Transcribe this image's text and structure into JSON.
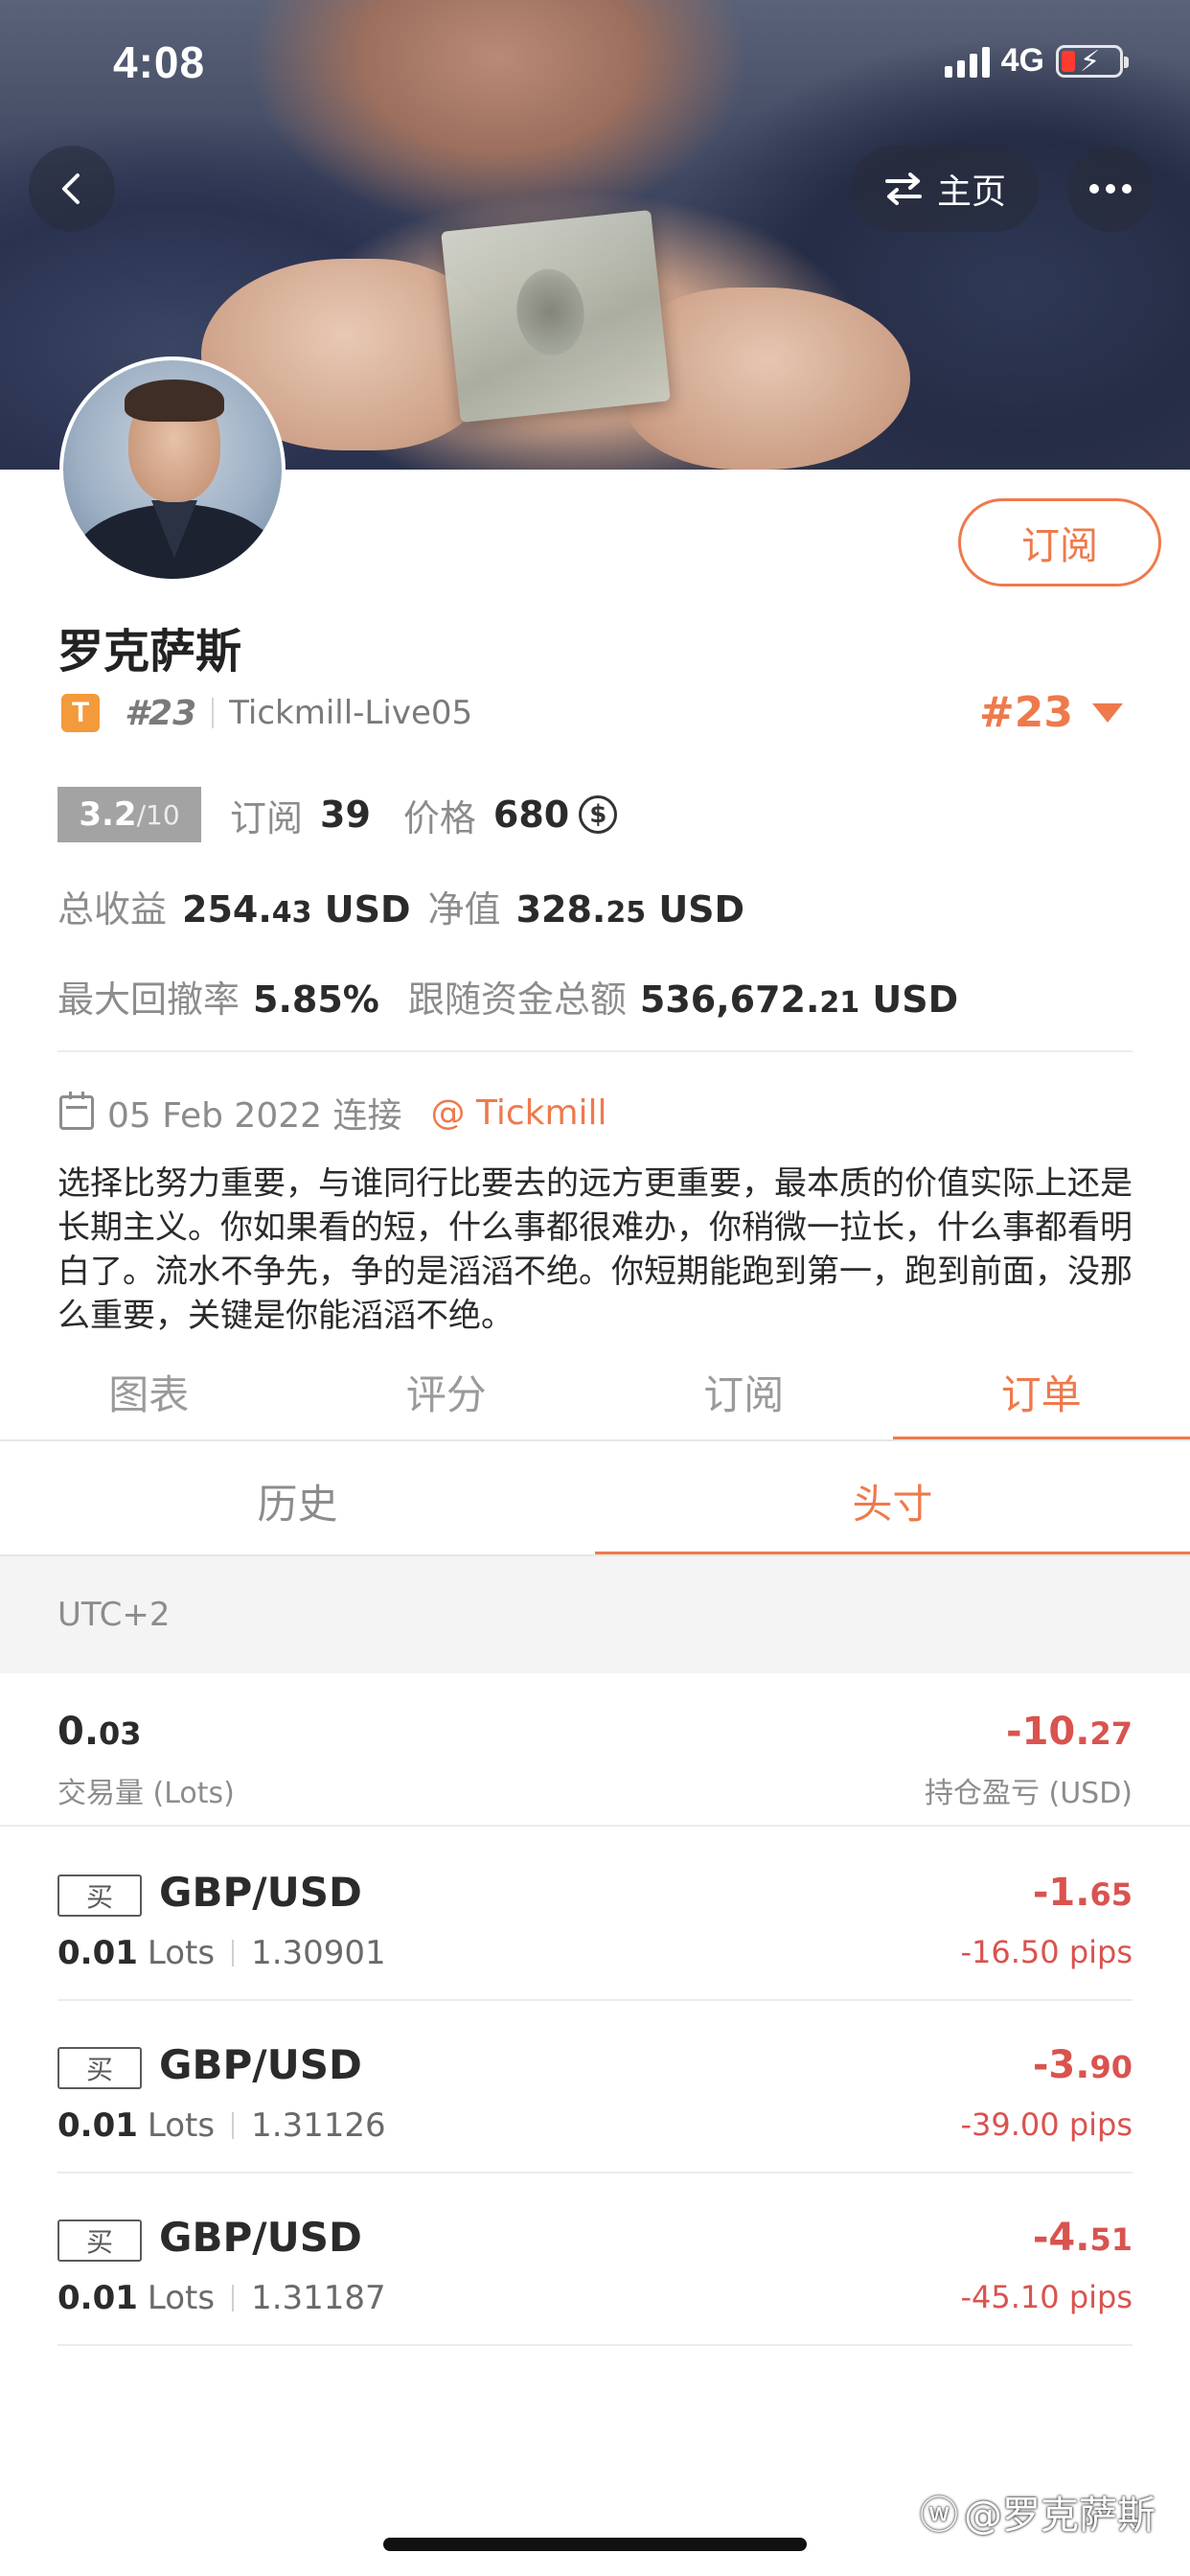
{
  "status_bar": {
    "time": "4:08",
    "network": "4G"
  },
  "header": {
    "home_label": "主页"
  },
  "profile": {
    "name": "罗克萨斯",
    "broker_badge": "T",
    "rank": "#23",
    "server": "Tickmill-Live05",
    "subscribe_label": "订阅",
    "score": "3.2",
    "score_max": "/10",
    "subscribers_label": "订阅",
    "subscribers": "39",
    "price_label": "价格",
    "price": "680",
    "coin_symbol": "$",
    "total_profit_label": "总收益",
    "total_profit_int": "254.",
    "total_profit_dec": "43",
    "currency": "USD",
    "equity_label": "净值",
    "equity_int": "328.",
    "equity_dec": "25",
    "max_drawdown_label": "最大回撤率",
    "max_drawdown": "5.85%",
    "follow_funds_label": "跟随资金总额",
    "follow_funds_int": "536,672.",
    "follow_funds_dec": "21",
    "connect_date": "05 Feb 2022 连接",
    "broker_link": "@ Tickmill",
    "bio": "选择比努力重要，与谁同行比要去的远方更重要，最本质的价值实际上还是长期主义。你如果看的短，什么事都很难办，你稍微一拉长，什么事都看明白了。流水不争先，争的是滔滔不绝。你短期能跑到第一，跑到前面，没那么重要，关键是你能滔滔不绝。"
  },
  "tabs": [
    "图表",
    "评分",
    "订阅",
    "订单"
  ],
  "active_tab": "订单",
  "subtabs": [
    "历史",
    "头寸"
  ],
  "timezone": "UTC+2",
  "summary": {
    "lots_int": "0.",
    "lots_dec": "03",
    "lots_label": "交易量 (Lots)",
    "pnl_int": "-10.",
    "pnl_dec": "27",
    "pnl_label": "持仓盈亏 (USD)"
  },
  "orders": [
    {
      "side": "买",
      "pair": "GBP/USD",
      "lots": "0.01",
      "lots_unit": "Lots",
      "price": "1.30901",
      "pnl_int": "-1.",
      "pnl_dec": "65",
      "pips": "-16.50 pips"
    },
    {
      "side": "买",
      "pair": "GBP/USD",
      "lots": "0.01",
      "lots_unit": "Lots",
      "price": "1.31126",
      "pnl_int": "-3.",
      "pnl_dec": "90",
      "pips": "-39.00 pips"
    },
    {
      "side": "买",
      "pair": "GBP/USD",
      "lots": "0.01",
      "lots_unit": "Lots",
      "price": "1.31187",
      "pnl_int": "-4.",
      "pnl_dec": "51",
      "pips": "-45.10 pips"
    }
  ],
  "watermark": "@罗克萨斯",
  "colors": {
    "accent": "#ee7a4c",
    "loss": "#d9534f",
    "muted": "#8c8c8c"
  }
}
